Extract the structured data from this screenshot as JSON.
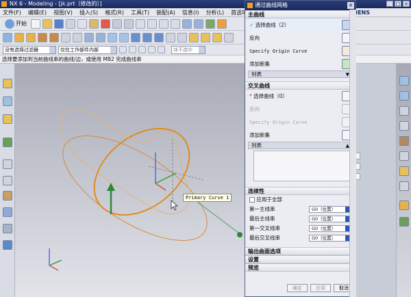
{
  "window": {
    "title": "NX 6 - Modeling - [jk.prt（修改的）]"
  },
  "menu": {
    "items": [
      "文件(F)",
      "编辑(E)",
      "视图(V)",
      "插入(S)",
      "格式(R)",
      "工具(T)",
      "装配(A)",
      "信息(I)",
      "分析(L)",
      "首选项(P)",
      "窗口"
    ]
  },
  "brand": "EMENS",
  "toolbar": {
    "start_label": "开始",
    "filter_value": "没有选择过滤器",
    "scope_value": "仅在工作部件内部",
    "snap_label": "体不选中"
  },
  "status_line": "选择要添加到当前曲线串的曲线/边，或使用 MB2 完成曲线串",
  "viewport": {
    "curve_label": "Primary Curve 1",
    "accent_color": "#e08a2a"
  },
  "dialog": {
    "title": "通过曲线网格",
    "primary": {
      "header": "主曲线",
      "select_label": "选择曲线（2）",
      "reverse_label": "反向",
      "origin_label": "Specify Origin Curve",
      "add_set_label": "添加新集",
      "list_label": "列表"
    },
    "cross": {
      "header": "交叉曲线",
      "select_label": "选择曲线（0）",
      "reverse_label": "反向",
      "origin_label": "Specify Origin Curve",
      "add_set_label": "添加新集",
      "list_label": "列表"
    },
    "continuity": {
      "header": "连续性",
      "apply_all": "应用于全部",
      "rows": [
        {
          "label": "第一主线串",
          "value": "G0（位置）"
        },
        {
          "label": "最后主线串",
          "value": "G0（位置）"
        },
        {
          "label": "第一交叉线串",
          "value": "G0（位置）"
        },
        {
          "label": "最后交叉线串",
          "value": "G0（位置）"
        }
      ]
    },
    "output_header": "输出曲面选项",
    "settings_header": "设置",
    "preview_header": "预览",
    "buttons": {
      "ok": "确定",
      "apply": "应用",
      "cancel": "取消"
    }
  }
}
